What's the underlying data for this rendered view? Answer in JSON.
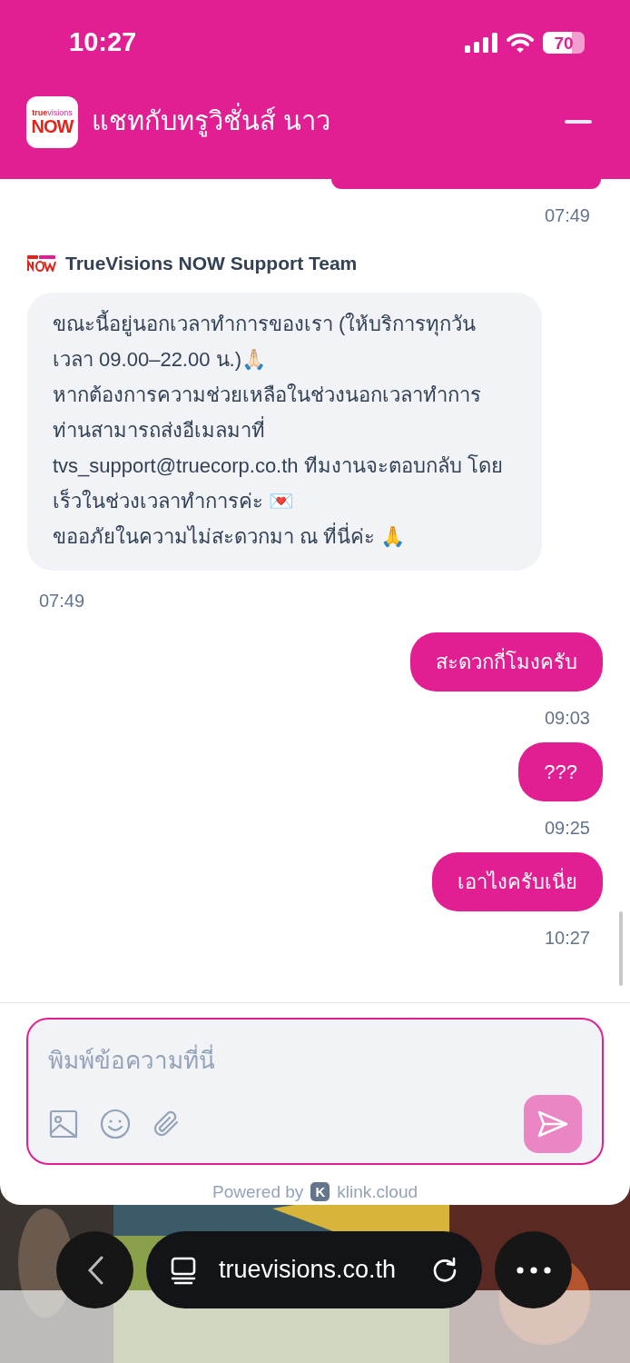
{
  "status_bar": {
    "time": "10:27",
    "battery": "70"
  },
  "header": {
    "logo": {
      "small": "true",
      "small_light": "visions",
      "main": "NOW"
    },
    "title": "แชทกับทรูวิชั่นส์ นาว"
  },
  "messages": [
    {
      "kind": "outgoing",
      "time": "07:49"
    },
    {
      "kind": "incoming",
      "name": "TrueVisions NOW Support Team",
      "text": "ขณะนี้อยู่นอกเวลาทำการของเรา (ให้บริการทุกวัน เวลา 09.00–22.00 น.)🙏🏻\nหากต้องการความช่วยเหลือในช่วงนอกเวลาทำการ ท่านสามารถส่งอีเมลมาที่\ntvs_support@truecorp.co.th ทีมงานจะตอบกลับ โดยเร็วในช่วงเวลาทำการค่ะ 💌\nขออภัยในความไม่สะดวกมา ณ ที่นี่ค่ะ 🙏",
      "time": "07:49"
    },
    {
      "kind": "outgoing",
      "text": "สะดวกกี่โมงครับ",
      "time": "09:03"
    },
    {
      "kind": "outgoing",
      "text": "???",
      "time": "09:25"
    },
    {
      "kind": "outgoing",
      "text": "เอาไงครับเนี่ย",
      "time": "10:27"
    }
  ],
  "composer": {
    "placeholder": "พิมพ์ข้อความที่นี่",
    "send_disabled": true
  },
  "footer": {
    "prefix": "Powered by",
    "logo_letter": "K",
    "brand": "klink.cloud"
  },
  "browser": {
    "url": "truevisions.co.th"
  }
}
